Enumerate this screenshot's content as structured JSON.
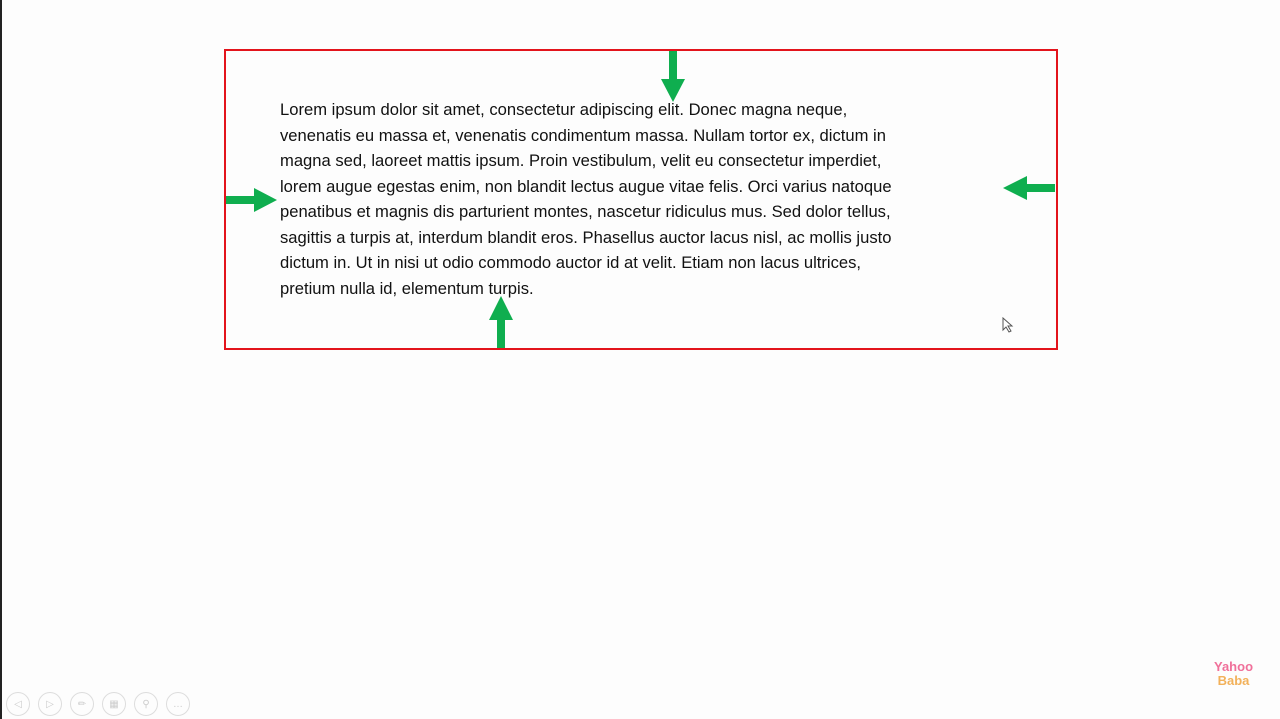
{
  "slide": {
    "paragraph_lines": [
      "Lorem ipsum dolor sit amet, consectetur adipiscing elit. Donec magna neque,",
      "venenatis eu massa et, venenatis condimentum massa. Nullam tortor ex, dictum in",
      "magna sed, laoreet mattis ipsum. Proin vestibulum, velit eu consectetur imperdiet,",
      "lorem augue egestas enim, non blandit lectus augue vitae felis. Orci varius natoque",
      "penatibus et magnis dis parturient montes, nascetur ridiculus mus. Sed dolor tellus,",
      "sagittis a turpis at, interdum blandit eros. Phasellus auctor lacus nisl, ac mollis justo",
      "dictum in. Ut in nisi ut odio commodo auctor id at velit. Etiam non lacus ultrices,",
      "pretium nulla id, elementum turpis."
    ],
    "border_color": "#e3141c",
    "arrow_color": "#0fae4f"
  },
  "controls": [
    "previous-icon",
    "next-icon",
    "pen-icon",
    "slides-grid-icon",
    "zoom-icon",
    "more-icon"
  ],
  "logo": {
    "line1": "Yahoo",
    "line2": "Baba"
  }
}
